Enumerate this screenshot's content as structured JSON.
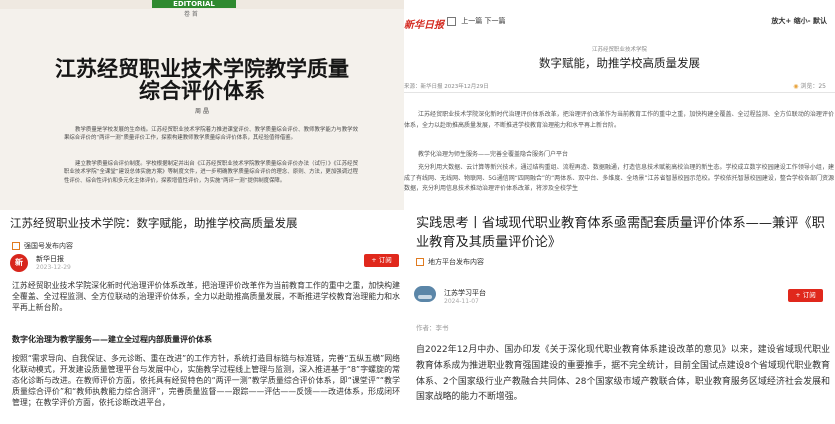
{
  "magazine": {
    "banner": "EDITORIAL",
    "subbanner": "卷 首",
    "title_line1": "江苏经贸职业技术学院教学质量",
    "title_line2": "综合评价体系",
    "author": "周  晶",
    "paragraphs": [
      "教学质量是学校发展的生命线。江苏经贸职业技术学院着力推进课堂评价、教学质量综合评价、教师教学能力与教学效果综合评价的“两评一测”质量评价工作，探索构建教师教学质量综合评价体系，其经验值得借鉴。",
      "建立教学质量综合评价制度。学校根据制定并出台《江苏经贸职业技术学院教学质量综合评价办法（试行）》《江苏经贸职业技术学院“全课堂”建设总体实施方案》等制度文件，进一步明确教学质量综合评价的理念、原则、方法，更加强调过程性评价、综合性评价和多元化主体评价，探索增值性评价，为实施“两评一测”提供制度保障。"
    ]
  },
  "web_article": {
    "logo": "新华日报",
    "nav_prev": "上一篇",
    "nav_next": "下一篇",
    "font_size": "放大+ 缩小- 默认",
    "school": "江苏经贸职业技术学院",
    "headline": "数字赋能，助推学校高质量发展",
    "meta": "来源：新华日报    2023年12月29日",
    "views": "浏览：25",
    "para1": "江苏经贸职业技术学院深化新时代治理评价体系改革，把治理评价改革作为当前教育工作的重中之重，加快构建全覆盖、全过程监测、全方位联动的治理评价体系，全力以赴助推高质量发展，不断推进学校教育治理能力和水平再上新台阶。",
    "sub": "教学化治理为师生服务——完善全覆盖隐合服务门户平台",
    "para2": "充分利用大数据、云计算等新兴技术，通过结构重组、流程再造、数据融通，打造信息技术赋能高校治理的新生态。学校成立数字校园建设工作领导小组，建成了有线网、无线网、物联网、5G通信网“四网融合”的“两体系、双中台、多维度、全场景”江苏省智慧校园示范校。学校依托智慧校园建设，整合学校各部门资源数据，充分利用信息技术推动治理评价体系改革，将涉及全校学生"
  },
  "feed_left": {
    "title": "江苏经贸职业技术学院：数字赋能，助推学校高质量发展",
    "tag": "强国号发布内容",
    "avatar_text": "新",
    "author": "新华日报",
    "date": "2023-12-29",
    "follow": "+ 订阅",
    "para1": "江苏经贸职业技术学院深化新时代治理评价体系改革，把治理评价改革作为当前教育工作的重中之重，加快构建全覆盖、全过程监测、全方位联动的治理评价体系，全力以赴助推高质量发展，不断推进学校教育治理能力和水平再上新台阶。",
    "subhead": "数字化治理为教学服务——建立全过程内部质量评价体系",
    "para2": "按照“需求导向、自我保证、多元诊断、重在改进”的工作方针，系统打造目标链与标准链，完善“五纵五横”网络化联动模式，开发建设质量管理平台与发展中心，实施教学过程线上管理与监测，深入推进基于“8”字螺旋的常态化诊断与改进。在教师评价方面，依托具有经贸特色的“两评一测”教学质量综合评价体系，即“课堂评”“教学质量综合评价”和“教师执教能力综合测评”，完善质量监督——跟踪——评估——反馈——改进体系，形成闭环管理；在教学评价方面，依托诊断改进平台，"
  },
  "feed_right": {
    "title": "实践思考丨省域现代职业教育体系亟需配套质量评价体系——兼评《职业教育及其质量评价论》",
    "tag": "地方平台发布内容",
    "author": "江苏学习平台",
    "date": "2024-11-07",
    "follow": "+ 订阅",
    "byline": "作者：李书",
    "para": "自2022年12月中办、国办印发《关于深化现代职业教育体系建设改革的意见》以来，建设省域现代职业教育体系成为推进职业教育强国建设的重要推手，据不完全统计，目前全国试点建设8个省域现代职业教育体系、2个国家级行业产教融合共同体、28个国家级市域产教联合体，职业教育服务区域经济社会发展和国家战略的能力不断增强。"
  }
}
